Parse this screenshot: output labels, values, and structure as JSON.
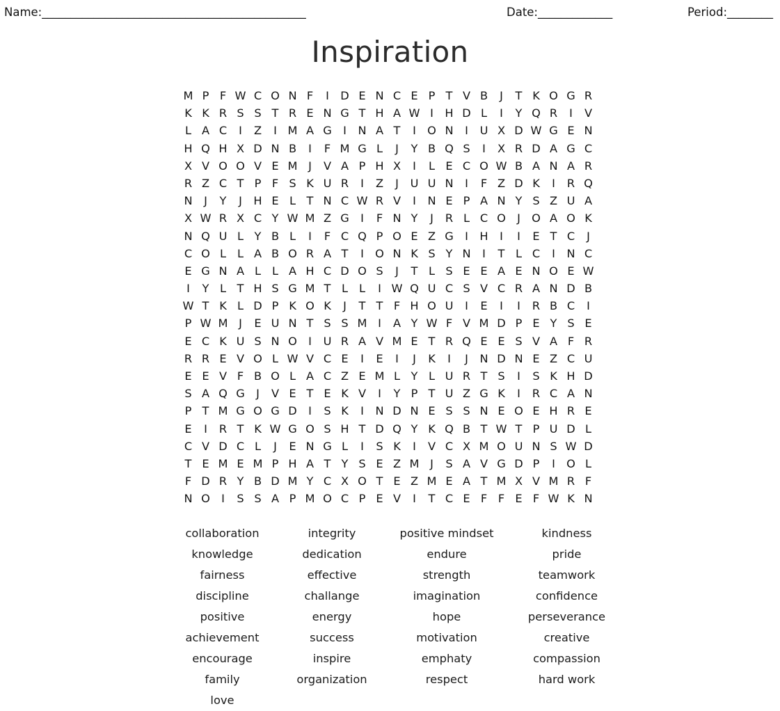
{
  "header": {
    "name_label": "Name:",
    "name_rule": "______________________________________________",
    "date_label": "Date:",
    "date_rule": "_____________",
    "period_label": "Period:",
    "period_rule": "________"
  },
  "title": "Inspiration",
  "grid": {
    "rows": 24,
    "cols": 24,
    "letters": [
      [
        "M",
        "P",
        "F",
        "W",
        "C",
        "O",
        "N",
        "F",
        "I",
        "D",
        "E",
        "N",
        "C",
        "E",
        "P",
        "T",
        "V",
        "B",
        "J",
        "T",
        "K",
        "O",
        "G",
        "R"
      ],
      [
        "K",
        "K",
        "R",
        "S",
        "S",
        "T",
        "R",
        "E",
        "N",
        "G",
        "T",
        "H",
        "A",
        "W",
        "I",
        "H",
        "D",
        "L",
        "I",
        "Y",
        "Q",
        "R",
        "I",
        "V"
      ],
      [
        "L",
        "A",
        "C",
        "I",
        "Z",
        "I",
        "M",
        "A",
        "G",
        "I",
        "N",
        "A",
        "T",
        "I",
        "O",
        "N",
        "I",
        "U",
        "X",
        "D",
        "W",
        "G",
        "E",
        "N"
      ],
      [
        "H",
        "Q",
        "H",
        "X",
        "D",
        "N",
        "B",
        "I",
        "F",
        "M",
        "G",
        "L",
        "J",
        "Y",
        "B",
        "Q",
        "S",
        "I",
        "X",
        "R",
        "D",
        "A",
        "G",
        "C"
      ],
      [
        "X",
        "V",
        "O",
        "O",
        "V",
        "E",
        "M",
        "J",
        "V",
        "A",
        "P",
        "H",
        "X",
        "I",
        "L",
        "E",
        "C",
        "O",
        "W",
        "B",
        "A",
        "N",
        "A",
        "R"
      ],
      [
        "R",
        "Z",
        "C",
        "T",
        "P",
        "F",
        "S",
        "K",
        "U",
        "R",
        "I",
        "Z",
        "J",
        "U",
        "U",
        "N",
        "I",
        "F",
        "Z",
        "D",
        "K",
        "I",
        "R",
        "Q"
      ],
      [
        "N",
        "J",
        "Y",
        "J",
        "H",
        "E",
        "L",
        "T",
        "N",
        "C",
        "W",
        "R",
        "V",
        "I",
        "N",
        "E",
        "P",
        "A",
        "N",
        "Y",
        "S",
        "Z",
        "U",
        "A"
      ],
      [
        "X",
        "W",
        "R",
        "X",
        "C",
        "Y",
        "W",
        "M",
        "Z",
        "G",
        "I",
        "F",
        "N",
        "Y",
        "J",
        "R",
        "L",
        "C",
        "O",
        "J",
        "O",
        "A",
        "O",
        "K"
      ],
      [
        "N",
        "Q",
        "U",
        "L",
        "Y",
        "B",
        "L",
        "I",
        "F",
        "C",
        "Q",
        "P",
        "O",
        "E",
        "Z",
        "G",
        "I",
        "H",
        "I",
        "I",
        "E",
        "T",
        "C",
        "J"
      ],
      [
        "C",
        "O",
        "L",
        "L",
        "A",
        "B",
        "O",
        "R",
        "A",
        "T",
        "I",
        "O",
        "N",
        "K",
        "S",
        "Y",
        "N",
        "I",
        "T",
        "L",
        "C",
        "I",
        "N",
        "C"
      ],
      [
        "E",
        "G",
        "N",
        "A",
        "L",
        "L",
        "A",
        "H",
        "C",
        "D",
        "O",
        "S",
        "J",
        "T",
        "L",
        "S",
        "E",
        "E",
        "A",
        "E",
        "N",
        "O",
        "E",
        "W"
      ],
      [
        "I",
        "Y",
        "L",
        "T",
        "H",
        "S",
        "G",
        "M",
        "T",
        "L",
        "L",
        "I",
        "W",
        "Q",
        "U",
        "C",
        "S",
        "V",
        "C",
        "R",
        "A",
        "N",
        "D",
        "B"
      ],
      [
        "W",
        "T",
        "K",
        "L",
        "D",
        "P",
        "K",
        "O",
        "K",
        "J",
        "T",
        "T",
        "F",
        "H",
        "O",
        "U",
        "I",
        "E",
        "I",
        "I",
        "R",
        "B",
        "C",
        "I"
      ],
      [
        "P",
        "W",
        "M",
        "J",
        "E",
        "U",
        "N",
        "T",
        "S",
        "S",
        "M",
        "I",
        "A",
        "Y",
        "W",
        "F",
        "V",
        "M",
        "D",
        "P",
        "E",
        "Y",
        "S",
        "E"
      ],
      [
        "E",
        "C",
        "K",
        "U",
        "S",
        "N",
        "O",
        "I",
        "U",
        "R",
        "A",
        "V",
        "M",
        "E",
        "T",
        "R",
        "Q",
        "E",
        "E",
        "S",
        "V",
        "A",
        "F",
        "R"
      ],
      [
        "R",
        "R",
        "E",
        "V",
        "O",
        "L",
        "W",
        "V",
        "C",
        "E",
        "I",
        "E",
        "I",
        "J",
        "K",
        "I",
        "J",
        "N",
        "D",
        "N",
        "E",
        "Z",
        "C",
        "U"
      ],
      [
        "E",
        "E",
        "V",
        "F",
        "B",
        "O",
        "L",
        "A",
        "C",
        "Z",
        "E",
        "M",
        "L",
        "Y",
        "L",
        "U",
        "R",
        "T",
        "S",
        "I",
        "S",
        "K",
        "H",
        "D"
      ],
      [
        "S",
        "A",
        "Q",
        "G",
        "J",
        "V",
        "E",
        "T",
        "E",
        "K",
        "V",
        "I",
        "Y",
        "P",
        "T",
        "U",
        "Z",
        "G",
        "K",
        "I",
        "R",
        "C",
        "A",
        "N"
      ],
      [
        "P",
        "T",
        "M",
        "G",
        "O",
        "G",
        "D",
        "I",
        "S",
        "K",
        "I",
        "N",
        "D",
        "N",
        "E",
        "S",
        "S",
        "N",
        "E",
        "O",
        "E",
        "H",
        "R",
        "E"
      ],
      [
        "E",
        "I",
        "R",
        "T",
        "K",
        "W",
        "G",
        "O",
        "S",
        "H",
        "T",
        "D",
        "Q",
        "Y",
        "K",
        "Q",
        "B",
        "T",
        "W",
        "T",
        "P",
        "U",
        "D",
        "L"
      ],
      [
        "C",
        "V",
        "D",
        "C",
        "L",
        "J",
        "E",
        "N",
        "G",
        "L",
        "I",
        "S",
        "K",
        "I",
        "V",
        "C",
        "X",
        "M",
        "O",
        "U",
        "N",
        "S",
        "W",
        "D"
      ],
      [
        "T",
        "E",
        "M",
        "E",
        "M",
        "P",
        "H",
        "A",
        "T",
        "Y",
        "S",
        "E",
        "Z",
        "M",
        "J",
        "S",
        "A",
        "V",
        "G",
        "D",
        "P",
        "I",
        "O",
        "L"
      ],
      [
        "F",
        "D",
        "R",
        "Y",
        "B",
        "D",
        "M",
        "Y",
        "C",
        "X",
        "O",
        "T",
        "E",
        "Z",
        "M",
        "E",
        "A",
        "T",
        "M",
        "X",
        "V",
        "M",
        "R",
        "F"
      ],
      [
        "N",
        "O",
        "I",
        "S",
        "S",
        "A",
        "P",
        "M",
        "O",
        "C",
        "P",
        "E",
        "V",
        "I",
        "T",
        "C",
        "E",
        "F",
        "F",
        "E",
        "F",
        "W",
        "K",
        "N"
      ]
    ]
  },
  "word_list": {
    "rows": [
      [
        "collaboration",
        "integrity",
        "positive mindset",
        "kindness"
      ],
      [
        "knowledge",
        "dedication",
        "endure",
        "pride"
      ],
      [
        "fairness",
        "effective",
        "strength",
        "teamwork"
      ],
      [
        "discipline",
        "challange",
        "imagination",
        "confidence"
      ],
      [
        "positive",
        "energy",
        "hope",
        "perseverance"
      ],
      [
        "achievement",
        "success",
        "motivation",
        "creative"
      ],
      [
        "encourage",
        "inspire",
        "emphaty",
        "compassion"
      ],
      [
        "family",
        "organization",
        "respect",
        "hard work"
      ],
      [
        "love",
        "",
        "",
        ""
      ]
    ]
  }
}
